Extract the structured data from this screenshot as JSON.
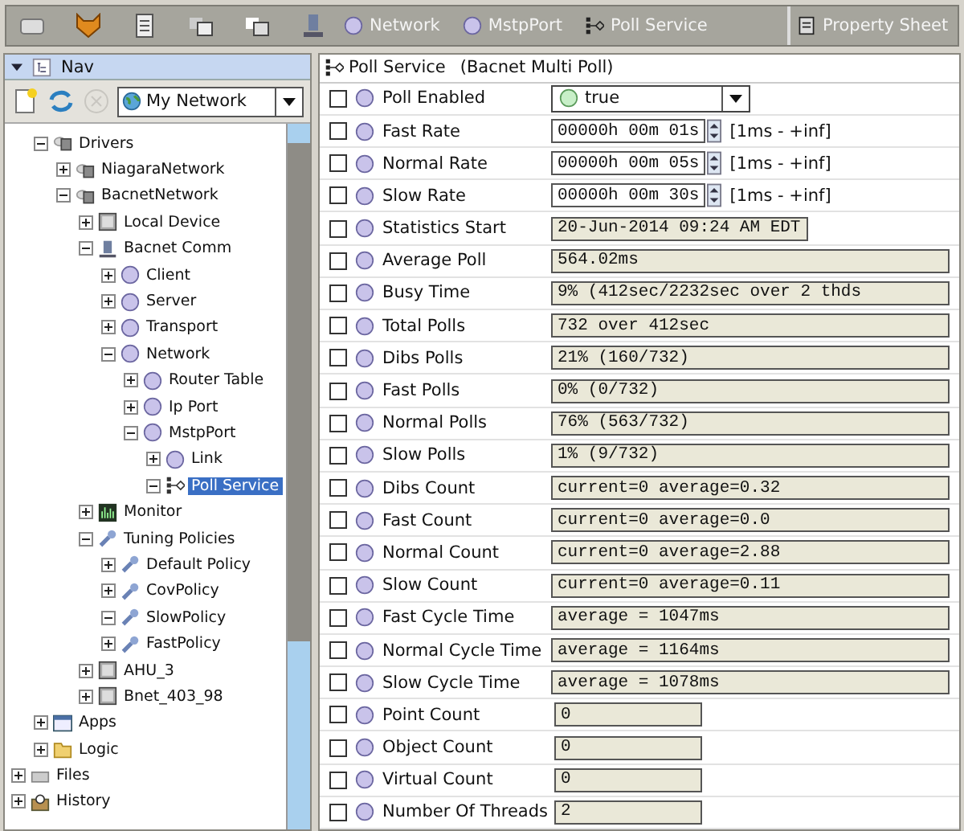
{
  "toolbar": {
    "breadcrumbs": [
      {
        "label": "Network",
        "kind": "component"
      },
      {
        "label": "MstpPort",
        "kind": "component"
      },
      {
        "label": "Poll Service",
        "kind": "service"
      }
    ],
    "view_selector": "Property Sheet"
  },
  "nav": {
    "title": "Nav",
    "expanded": true,
    "network": "My Network"
  },
  "tree": {
    "items": [
      {
        "children": [
          {
            "label": "Drivers",
            "kind": "network",
            "expanded": true,
            "selected": false,
            "children": [
              {
                "label": "NiagaraNetwork",
                "kind": "network",
                "expanded": false,
                "selected": false
              },
              {
                "label": "BacnetNetwork",
                "kind": "network",
                "expanded": true,
                "selected": false,
                "children": [
                  {
                    "label": "Local Device",
                    "kind": "device",
                    "expanded": false,
                    "selected": false
                  },
                  {
                    "label": "Bacnet Comm",
                    "kind": "comm",
                    "expanded": true,
                    "selected": false,
                    "children": [
                      {
                        "label": "Client",
                        "kind": "component",
                        "expanded": false,
                        "selected": false
                      },
                      {
                        "label": "Server",
                        "kind": "component",
                        "expanded": false,
                        "selected": false
                      },
                      {
                        "label": "Transport",
                        "kind": "component",
                        "expanded": false,
                        "selected": false
                      },
                      {
                        "label": "Network",
                        "kind": "component",
                        "expanded": true,
                        "selected": false,
                        "children": [
                          {
                            "label": "Router Table",
                            "kind": "component",
                            "expanded": false,
                            "selected": false
                          },
                          {
                            "label": "Ip Port",
                            "kind": "component",
                            "expanded": false,
                            "selected": false
                          },
                          {
                            "label": "MstpPort",
                            "kind": "component",
                            "expanded": true,
                            "selected": false,
                            "children": [
                              {
                                "label": "Link",
                                "kind": "component",
                                "expanded": false,
                                "selected": false
                              },
                              {
                                "label": "Poll Service",
                                "kind": "service",
                                "expanded": true,
                                "selected": true
                              }
                            ]
                          }
                        ]
                      }
                    ]
                  },
                  {
                    "label": "Monitor",
                    "kind": "monitor",
                    "expanded": false,
                    "selected": false
                  },
                  {
                    "label": "Tuning Policies",
                    "kind": "wrench",
                    "expanded": true,
                    "selected": false,
                    "children": [
                      {
                        "label": "Default Policy",
                        "kind": "wrench",
                        "expanded": false,
                        "selected": false
                      },
                      {
                        "label": "CovPolicy",
                        "kind": "wrench",
                        "expanded": false,
                        "selected": false
                      },
                      {
                        "label": "SlowPolicy",
                        "kind": "wrench",
                        "expanded": true,
                        "selected": false
                      },
                      {
                        "label": "FastPolicy",
                        "kind": "wrench",
                        "expanded": false,
                        "selected": false
                      }
                    ]
                  },
                  {
                    "label": "AHU_3",
                    "kind": "device",
                    "expanded": false,
                    "selected": false
                  },
                  {
                    "label": "Bnet_403_98",
                    "kind": "device",
                    "expanded": false,
                    "selected": false
                  }
                ]
              }
            ]
          },
          {
            "label": "Apps",
            "kind": "apps",
            "expanded": false,
            "selected": false
          },
          {
            "label": "Logic",
            "kind": "folder",
            "expanded": false,
            "selected": false
          }
        ]
      },
      {
        "label": "Files",
        "kind": "files",
        "expanded": false,
        "selected": false
      },
      {
        "label": "History",
        "kind": "history",
        "expanded": false,
        "selected": false
      }
    ]
  },
  "sheet": {
    "title": "Poll Service",
    "type": "(Bacnet Multi Poll)",
    "rows": [
      {
        "label": "Poll Enabled",
        "kind": "dropdown",
        "value": "true",
        "checked": false
      },
      {
        "label": "Fast Rate",
        "kind": "duration",
        "value": "00000h 00m 01s",
        "range": "[1ms - +inf]",
        "checked": false
      },
      {
        "label": "Normal Rate",
        "kind": "duration",
        "value": "00000h 00m 05s",
        "range": "[1ms - +inf]",
        "checked": false
      },
      {
        "label": "Slow Rate",
        "kind": "duration",
        "value": "00000h 00m 30s",
        "range": "[1ms - +inf]",
        "checked": false
      },
      {
        "label": "Statistics Start",
        "kind": "timestamp",
        "value": "20-Jun-2014 09:24 AM EDT",
        "checked": false
      },
      {
        "label": "Average Poll",
        "kind": "text",
        "value": "564.02ms",
        "checked": false
      },
      {
        "label": "Busy Time",
        "kind": "text",
        "value": "9% (412sec/2232sec over 2 thds",
        "checked": false
      },
      {
        "label": "Total Polls",
        "kind": "text",
        "value": "732 over 412sec",
        "checked": false
      },
      {
        "label": "Dibs Polls",
        "kind": "text",
        "value": "21% (160/732)",
        "checked": false
      },
      {
        "label": "Fast Polls",
        "kind": "text",
        "value": "0% (0/732)",
        "checked": false
      },
      {
        "label": "Normal Polls",
        "kind": "text",
        "value": "76% (563/732)",
        "checked": false
      },
      {
        "label": "Slow Polls",
        "kind": "text",
        "value": "1% (9/732)",
        "checked": false
      },
      {
        "label": "Dibs Count",
        "kind": "text",
        "value": "current=0 average=0.32",
        "checked": false
      },
      {
        "label": "Fast Count",
        "kind": "text",
        "value": "current=0 average=0.0",
        "checked": false
      },
      {
        "label": "Normal Count",
        "kind": "text",
        "value": "current=0 average=2.88",
        "checked": false
      },
      {
        "label": "Slow Count",
        "kind": "text",
        "value": "current=0 average=0.11",
        "checked": false
      },
      {
        "label": "Fast Cycle Time",
        "kind": "text",
        "value": "average = 1047ms",
        "checked": false
      },
      {
        "label": "Normal Cycle Time",
        "kind": "text",
        "value": "average = 1164ms",
        "checked": false
      },
      {
        "label": "Slow Cycle Time",
        "kind": "text",
        "value": "average = 1078ms",
        "checked": false
      },
      {
        "label": "Point Count",
        "kind": "count",
        "value": "0",
        "checked": false
      },
      {
        "label": "Object Count",
        "kind": "count",
        "value": "0",
        "checked": false
      },
      {
        "label": "Virtual Count",
        "kind": "count",
        "value": "0",
        "checked": false
      },
      {
        "label": "Number Of Threads",
        "kind": "count",
        "value": "2",
        "checked": false
      }
    ]
  }
}
